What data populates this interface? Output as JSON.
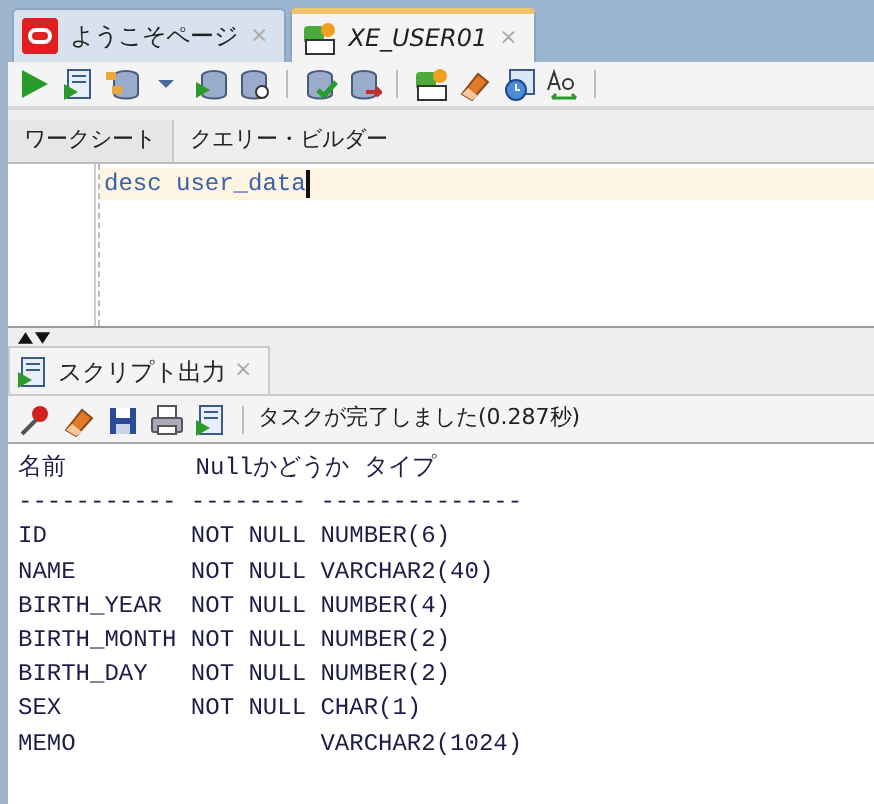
{
  "tabs": [
    {
      "label": "ようこそページ",
      "selected": false,
      "close": "×"
    },
    {
      "label": "XE_USER01",
      "selected": true,
      "close": "×"
    }
  ],
  "subtabs": [
    {
      "label": "ワークシート",
      "selected": true
    },
    {
      "label": "クエリー・ビルダー",
      "selected": false
    }
  ],
  "editor": {
    "code": "desc user_data"
  },
  "output_panel": {
    "tab": {
      "label": "スクリプト出力",
      "close": "×"
    },
    "status": "タスクが完了しました(0.287秒)",
    "lines": [
      "名前         Nullかどうか タイプ",
      "----------- -------- --------------",
      "ID          NOT NULL NUMBER(6)",
      "NAME        NOT NULL VARCHAR2(40)",
      "BIRTH_YEAR  NOT NULL NUMBER(4)",
      "BIRTH_MONTH NOT NULL NUMBER(2)",
      "BIRTH_DAY   NOT NULL NUMBER(2)",
      "SEX         NOT NULL CHAR(1)",
      "MEMO                 VARCHAR2(1024)"
    ]
  }
}
